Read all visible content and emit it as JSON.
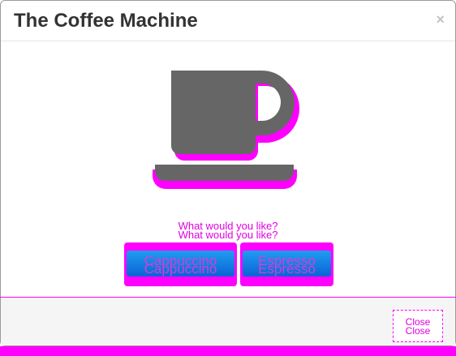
{
  "modal": {
    "title": "The Coffee Machine",
    "close_symbol": "×"
  },
  "body": {
    "icon": "coffee-cup-icon",
    "prompt": "What would you like?",
    "options": [
      {
        "label": "Cappuccino"
      },
      {
        "label": "Espresso"
      }
    ]
  },
  "footer": {
    "close_label": "Close"
  },
  "colors": {
    "title": "#333333",
    "cup": "#666666",
    "highlight": "#ff00ff",
    "button_top": "#1f9df0",
    "button_bottom": "#0b63d6",
    "footer_bg": "#f5f5f5"
  }
}
